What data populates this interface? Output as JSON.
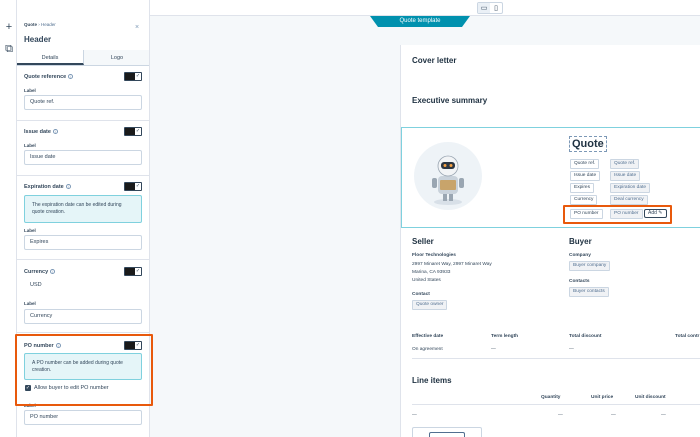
{
  "rail": {
    "add_icon": "+",
    "tree_icon": "⧉"
  },
  "device_toggle": {
    "desktop_icon": "▭",
    "mobile_icon": "▯"
  },
  "template_tab": "Quote template",
  "panel": {
    "breadcrumb_root": "Quote",
    "breadcrumb_sep": "›",
    "breadcrumb_current": "Header",
    "title": "Header",
    "close": "×",
    "tabs": [
      {
        "label": "Details"
      },
      {
        "label": "Logo"
      }
    ],
    "quote_reference": {
      "title": "Quote reference",
      "label": "Label",
      "value": "Quote ref."
    },
    "issue_date": {
      "title": "Issue date",
      "label": "Label",
      "value": "Issue date"
    },
    "expiration_date": {
      "title": "Expiration date",
      "notice": "The expiration date can be edited during quote creation.",
      "label": "Label",
      "value": "Expires"
    },
    "currency": {
      "title": "Currency",
      "value": "USD",
      "label": "Label",
      "field_value": "Currency"
    },
    "po_number": {
      "title": "PO number",
      "notice": "A PO number can be added during quote creation.",
      "checkbox_label": "Allow buyer to edit PO number",
      "label": "Label",
      "value": "PO number"
    },
    "info": "i",
    "check": "✓"
  },
  "doc": {
    "cover_letter": "Cover letter",
    "exec_summary": "Executive summary",
    "quote_title": "Quote",
    "rows": [
      {
        "label": "Quote ref.",
        "value": "Quote ref."
      },
      {
        "label": "Issue date",
        "value": "Issue date"
      },
      {
        "label": "Expires",
        "value": "Expiration date"
      },
      {
        "label": "Currency",
        "value": "Deal currency"
      }
    ],
    "po_label": "PO number",
    "po_value": "PO number",
    "add_label": "Add",
    "add_icon": "✎",
    "seller": {
      "heading": "Seller",
      "company": "Floor Technologies",
      "addr1": "2997 Minaret Way, 2997 Minaret Way",
      "addr2": "Marina, CA 93933",
      "addr3": "United States",
      "contact_label": "Contact",
      "contact_value": "Quote owner"
    },
    "buyer": {
      "heading": "Buyer",
      "company_label": "Company",
      "company_value": "Buyer company",
      "contacts_label": "Contacts",
      "contacts_value": "Buyer contacts"
    },
    "terms": {
      "effective_date": "Effective date",
      "term_length": "Term length",
      "total_discount": "Total discount",
      "total_contract": "Total contr",
      "effective_value": "On agreement",
      "term_value": "—",
      "discount_value": "—"
    },
    "line_items": {
      "heading": "Line items",
      "quantity": "Quantity",
      "unit_price": "Unit price",
      "unit_discount": "Unit discount",
      "dash": "—"
    }
  }
}
